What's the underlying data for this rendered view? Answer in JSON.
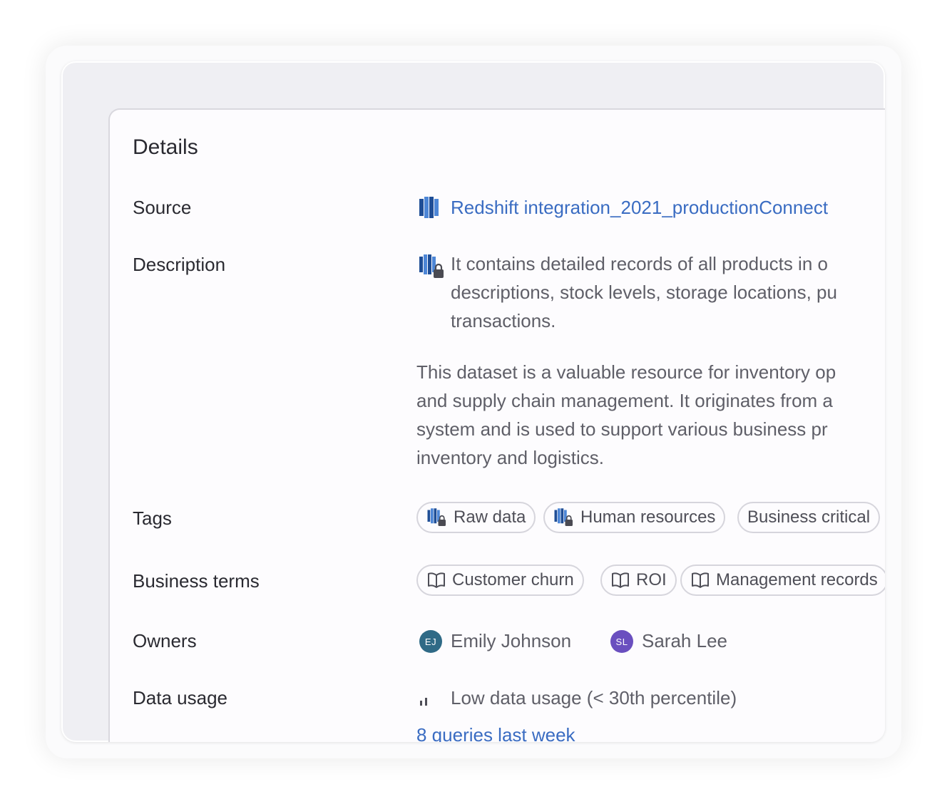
{
  "details": {
    "title": "Details",
    "source": {
      "label": "Source",
      "value": "Redshift integration_2021_productionConnect",
      "icon": "redshift-icon"
    },
    "description": {
      "label": "Description",
      "lines": [
        "It contains detailed records of all products in o",
        "descriptions, stock levels, storage locations, pu",
        "transactions."
      ],
      "paragraph2": [
        "This dataset is a valuable resource for inventory op",
        "and supply chain management. It originates from a",
        "system and is used to support various business pr",
        "inventory and logistics."
      ],
      "icon": "redshift-locked-icon"
    },
    "tags": {
      "label": "Tags",
      "items": [
        {
          "label": "Raw data",
          "icon": "redshift-locked-icon"
        },
        {
          "label": "Human resources",
          "icon": "redshift-locked-icon"
        },
        {
          "label": "Business critical"
        }
      ]
    },
    "business_terms": {
      "label": "Business terms",
      "items": [
        {
          "label": "Customer churn",
          "icon": "book-icon"
        },
        {
          "label": "ROI",
          "icon": "book-icon"
        },
        {
          "label": "Management records",
          "icon": "book-icon"
        }
      ]
    },
    "owners": {
      "label": "Owners",
      "items": [
        {
          "initials": "EJ",
          "name": "Emily Johnson",
          "color": "#2f6a86"
        },
        {
          "initials": "SL",
          "name": "Sarah Lee",
          "color": "#6a4fbf"
        }
      ]
    },
    "data_usage": {
      "label": "Data usage",
      "summary": "Low data usage (< 30th percentile)",
      "queries": "8 queries last week"
    }
  },
  "colors": {
    "link": "#3a6cc2",
    "redshift_dark": "#1f4e96",
    "redshift_light": "#4d86d6"
  }
}
